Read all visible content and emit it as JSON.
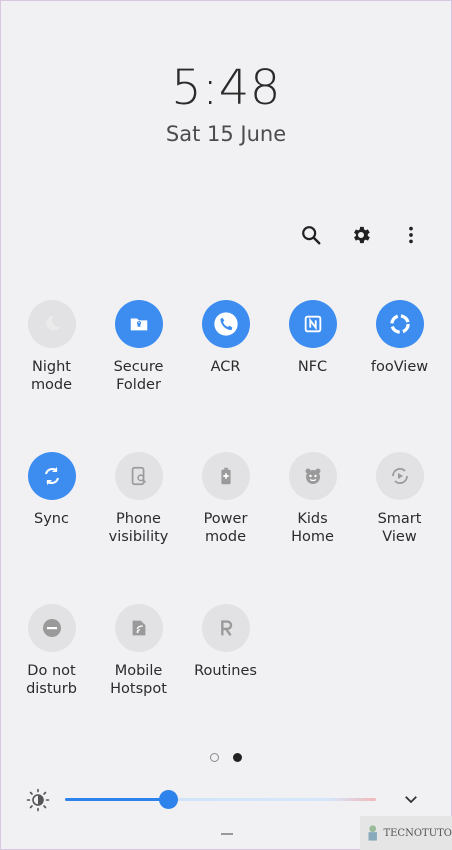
{
  "header": {
    "time": "5:48",
    "date": "Sat 15 June"
  },
  "top_actions": [
    {
      "name": "search-icon"
    },
    {
      "name": "gear-icon"
    },
    {
      "name": "more-vert-icon"
    }
  ],
  "tiles": [
    {
      "label": "Night\nmode",
      "icon": "moon-icon",
      "active": false
    },
    {
      "label": "Secure\nFolder",
      "icon": "secure-folder-icon",
      "active": true
    },
    {
      "label": "ACR",
      "icon": "phone-icon",
      "active": true
    },
    {
      "label": "NFC",
      "icon": "nfc-icon",
      "active": true
    },
    {
      "label": "fooView",
      "icon": "fooview-icon",
      "active": true
    },
    {
      "label": "Sync",
      "icon": "sync-icon",
      "active": true
    },
    {
      "label": "Phone\nvisibility",
      "icon": "phone-visibility-icon",
      "active": false
    },
    {
      "label": "Power\nmode",
      "icon": "power-mode-icon",
      "active": false
    },
    {
      "label": "Kids\nHome",
      "icon": "kids-home-icon",
      "active": false
    },
    {
      "label": "Smart\nView",
      "icon": "smart-view-icon",
      "active": false
    },
    {
      "label": "Do not\ndisturb",
      "icon": "do-not-disturb-icon",
      "active": false
    },
    {
      "label": "Mobile\nHotspot",
      "icon": "hotspot-icon",
      "active": false
    },
    {
      "label": "Routines",
      "icon": "routines-icon",
      "active": false
    }
  ],
  "pager": {
    "pages": 2,
    "current": 2
  },
  "brightness": {
    "level": 0.33
  },
  "watermark": {
    "text": "TECNOTUTO"
  }
}
